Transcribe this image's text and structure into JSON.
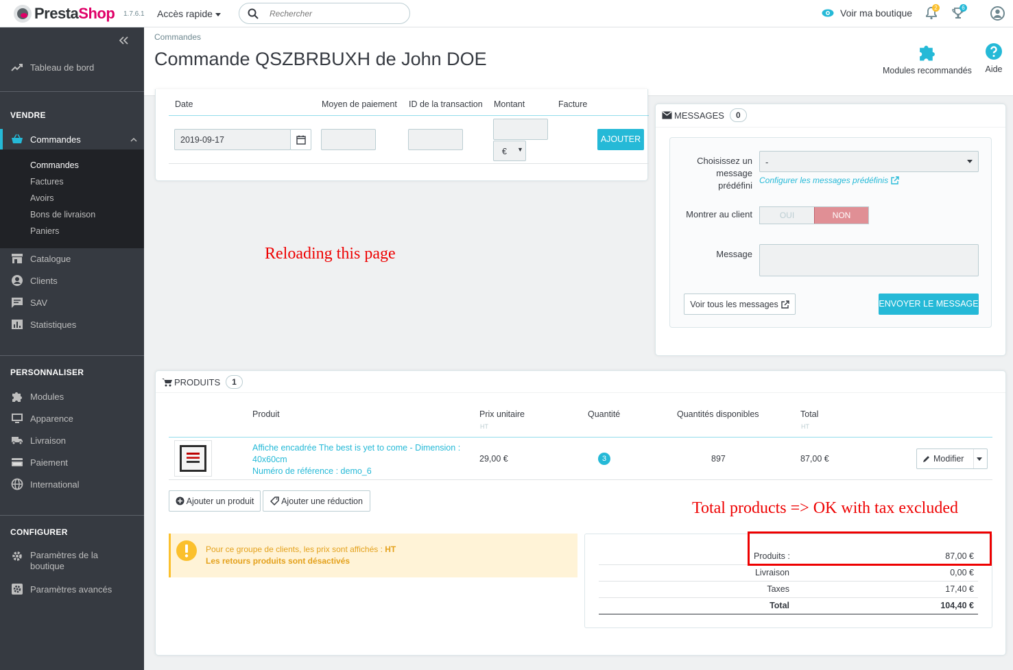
{
  "topbar": {
    "logo_main": "Presta",
    "logo_accent": "Shop",
    "version": "1.7.6.1",
    "quick_access": "Accès rapide",
    "search_placeholder": "Rechercher",
    "view_shop": "Voir ma boutique",
    "notifications_count": "2",
    "trophy_count": "6"
  },
  "sidebar": {
    "dashboard": "Tableau de bord",
    "section_sell": "VENDRE",
    "orders": "Commandes",
    "orders_sub": [
      "Commandes",
      "Factures",
      "Avoirs",
      "Bons de livraison",
      "Paniers"
    ],
    "catalog": "Catalogue",
    "customers": "Clients",
    "sav": "SAV",
    "stats": "Statistiques",
    "section_customize": "PERSONNALISER",
    "modules": "Modules",
    "appearance": "Apparence",
    "shipping": "Livraison",
    "payment": "Paiement",
    "international": "International",
    "section_configure": "CONFIGURER",
    "shop_params": "Paramètres de la boutique",
    "advanced_params": "Paramètres avancés"
  },
  "header": {
    "breadcrumb": "Commandes",
    "title": "Commande QSZBRBUXH de John DOE",
    "modules_btn": "Modules recommandés",
    "help_btn": "Aide"
  },
  "payment": {
    "col_date": "Date",
    "col_method": "Moyen de paiement",
    "col_transaction": "ID de la transaction",
    "col_amount": "Montant",
    "col_invoice": "Facture",
    "date_value": "2019-09-17",
    "currency": "€",
    "add_button": "AJOUTER"
  },
  "messages": {
    "title": "MESSAGES",
    "count": "0",
    "predefined_label": "Choisissez un message prédéfini",
    "predefined_value": "-",
    "configure_link": "Configurer les messages prédéfinis",
    "show_customer_label": "Montrer au client",
    "toggle_yes": "OUI",
    "toggle_no": "NON",
    "message_label": "Message",
    "view_all": "Voir tous les messages",
    "send": "ENVOYER LE MESSAGE"
  },
  "notes": {
    "reload": "Reloading this page",
    "total_ok": "Total products => OK with tax excluded"
  },
  "products": {
    "title": "PRODUITS",
    "count": "1",
    "col_product": "Produit",
    "col_unit_price": "Prix unitaire",
    "col_unit_price_sub": "HT",
    "col_qty": "Quantité",
    "col_available": "Quantités disponibles",
    "col_total": "Total",
    "col_total_sub": "HT",
    "rows": [
      {
        "name_line1": "Affiche encadrée The best is yet to come - Dimension :",
        "name_line2": "40x60cm",
        "reference": "Numéro de référence : demo_6",
        "unit_price": "29,00 €",
        "quantity": "3",
        "available": "897",
        "total": "87,00 €",
        "edit": "Modifier"
      }
    ],
    "add_product": "Ajouter un produit",
    "add_discount": "Ajouter une réduction"
  },
  "alert": {
    "line1_prefix": "Pour ce groupe de clients, les prix sont affichés :",
    "line1_value": "HT",
    "line2": "Les retours produits sont désactivés"
  },
  "totals": {
    "products_label": "Produits :",
    "products_value": "87,00 €",
    "shipping_label": "Livraison",
    "shipping_value": "0,00 €",
    "taxes_label": "Taxes",
    "taxes_value": "17,40 €",
    "total_label": "Total",
    "total_value": "104,40 €"
  },
  "colors": {
    "accent": "#25b9d7",
    "sidebar": "#363a41",
    "danger_toggle": "#e08f95",
    "warning": "#fbc02d",
    "annotation": "#e00000"
  }
}
